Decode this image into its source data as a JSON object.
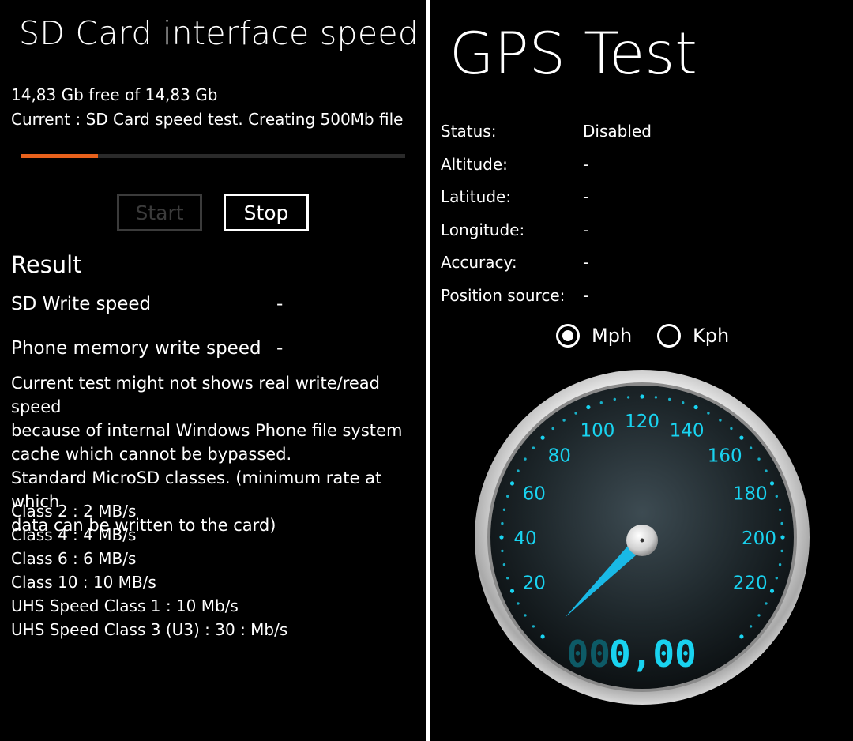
{
  "sd": {
    "title": "SD Card interface speed",
    "free_line": "14,83 Gb free of 14,83 Gb",
    "current_line": "Current : SD Card speed test. Creating 500Mb file",
    "progress": 0.2,
    "progress_color": "#e8611c",
    "start_label": "Start",
    "stop_label": "Stop",
    "result_heading": "Result",
    "write_label": "SD Write speed",
    "write_value": "-",
    "phone_label": "Phone memory write speed",
    "phone_value": "-",
    "note": "Current test might not shows real write/read speed because of internal Windows Phone file system cache which cannot be bypassed. Standard MicroSD classes. (minimum rate at which data can be written to the card)",
    "note_line1": "Current test might not shows real write/read speed",
    "note_line2": "because of internal Windows Phone file system",
    "note_line3": "cache which cannot be bypassed.",
    "note_line4": "Standard MicroSD classes. (minimum rate at which",
    "note_line5": "data can be written to the card)",
    "classes": [
      "Class 2 : 2 MB/s",
      "Class 4 : 4 MB/s",
      "Class 6 : 6 MB/s",
      "Class 10 : 10 MB/s",
      "UHS Speed Class 1 : 10 Mb/s",
      "UHS Speed Class 3 (U3) : 30 : Mb/s"
    ]
  },
  "gps": {
    "title": "GPS Test",
    "rows": [
      {
        "label": "Status:",
        "value": "Disabled"
      },
      {
        "label": "Altitude:",
        "value": "-"
      },
      {
        "label": "Latitude:",
        "value": "-"
      },
      {
        "label": "Longitude:",
        "value": "-"
      },
      {
        "label": "Accuracy:",
        "value": "-"
      },
      {
        "label": "Position source:",
        "value": "-"
      }
    ],
    "units": [
      {
        "label": "Mph",
        "selected": true
      },
      {
        "label": "Kph",
        "selected": false
      }
    ],
    "speedometer": {
      "tick_labels": [
        "20",
        "40",
        "60",
        "80",
        "100",
        "120",
        "140",
        "160",
        "180",
        "200",
        "220"
      ],
      "min": 0,
      "max": 240,
      "speed": 0,
      "display_dim": "00",
      "display_value": "0,00",
      "accent": "#19d3f0"
    }
  }
}
